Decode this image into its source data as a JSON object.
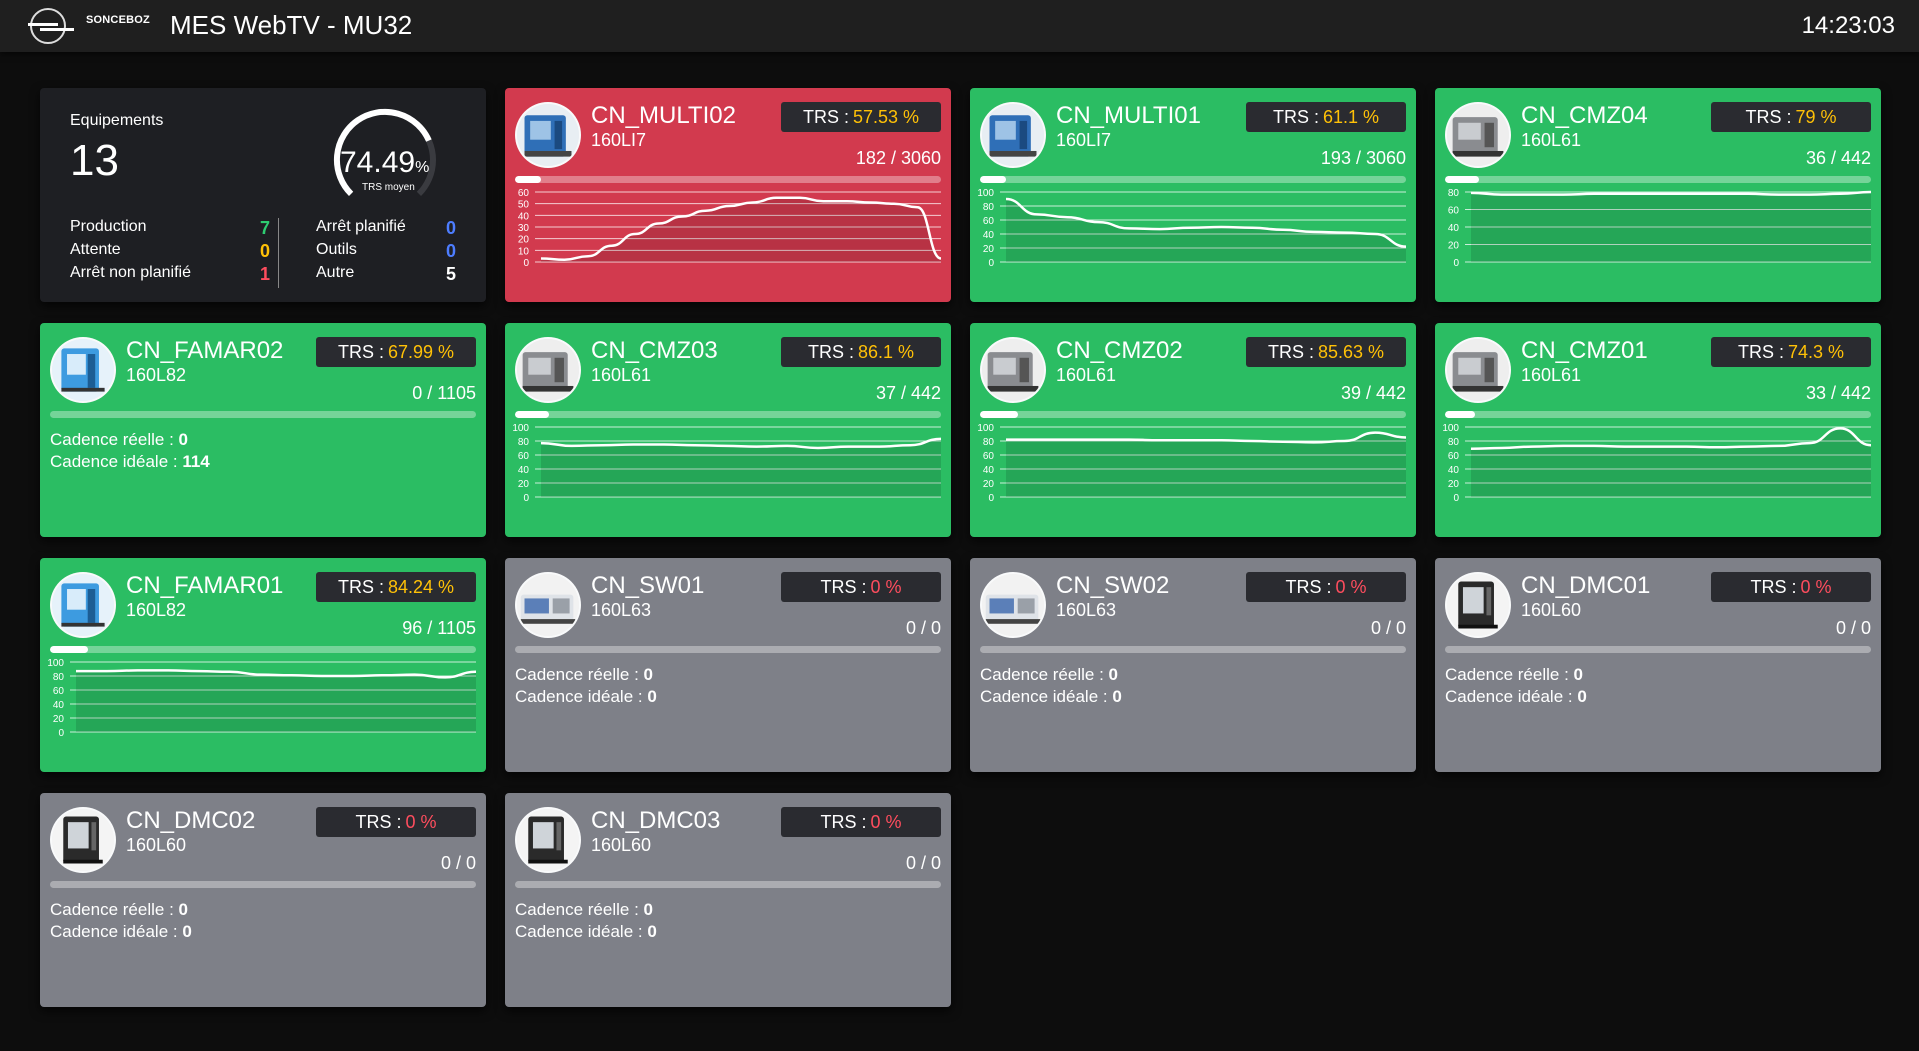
{
  "header": {
    "brand": "SONCEBOZ",
    "title": "MES WebTV - MU32",
    "clock": "14:23:03"
  },
  "colors": {
    "green": "#2bbd63",
    "red": "#d23a4e",
    "grey": "#7e8088",
    "trs_yellow": "#ffc107",
    "trs_red": "#ff4d5e"
  },
  "summary": {
    "label": "Equipements",
    "count": "13",
    "trs_value": "74.49",
    "trs_unit": "%",
    "trs_caption": "TRS moyen",
    "trs_fraction": 0.7449,
    "left_stats": [
      {
        "label": "Production",
        "value": "7",
        "color": "#2ecc71"
      },
      {
        "label": "Attente",
        "value": "0",
        "color": "#ffc107"
      },
      {
        "label": "Arrêt non planifié",
        "value": "1",
        "color": "#ff4d5e"
      }
    ],
    "right_stats": [
      {
        "label": "Arrêt planifié",
        "value": "0",
        "color": "#4d7dff"
      },
      {
        "label": "Outils",
        "value": "0",
        "color": "#4d7dff"
      },
      {
        "label": "Autre",
        "value": "5",
        "color": "#ffffff"
      }
    ]
  },
  "machines": [
    {
      "name": "CN_MULTI02",
      "ref": "160LI7",
      "trs_label": "TRS :",
      "trs": "57.53 %",
      "trs_color": "yellow",
      "counter": "182 / 3060",
      "progress": 0.06,
      "status": "red",
      "icon": "lathe-blue-icon",
      "chart": {
        "y_ticks": [
          "60",
          "50",
          "40",
          "30",
          "20",
          "10",
          "0"
        ],
        "ymax": 60,
        "values": [
          3,
          2,
          5,
          14,
          24,
          33,
          39,
          44,
          48,
          51,
          55,
          55,
          52,
          52,
          51,
          50,
          47,
          3
        ]
      }
    },
    {
      "name": "CN_MULTI01",
      "ref": "160LI7",
      "trs_label": "TRS :",
      "trs": "61.1 %",
      "trs_color": "yellow",
      "counter": "193 / 3060",
      "progress": 0.06,
      "status": "green",
      "icon": "lathe-blue-icon",
      "chart": {
        "y_ticks": [
          "100",
          "80",
          "60",
          "40",
          "20",
          "0"
        ],
        "ymax": 100,
        "values": [
          90,
          68,
          64,
          57,
          48,
          47,
          49,
          50,
          49,
          46,
          43,
          42,
          40,
          22
        ]
      }
    },
    {
      "name": "CN_CMZ04",
      "ref": "160L61",
      "trs_label": "TRS :",
      "trs": "79 %",
      "trs_color": "yellow",
      "counter": "36 / 442",
      "progress": 0.08,
      "status": "green",
      "icon": "lathe-grey-icon",
      "chart": {
        "y_ticks": [
          "80",
          "60",
          "40",
          "20",
          "0"
        ],
        "ymax": 80,
        "values": [
          79,
          77,
          77,
          77,
          78,
          78,
          78,
          78,
          78,
          78,
          77,
          77,
          78,
          80
        ]
      }
    },
    {
      "name": "CN_FAMAR02",
      "ref": "160L82",
      "trs_label": "TRS :",
      "trs": "67.99 %",
      "trs_color": "yellow",
      "counter": "0 / 1105",
      "progress": 0,
      "status": "green",
      "icon": "famar-icon",
      "cadence_real_label": "Cadence réelle :",
      "cadence_real": "0",
      "cadence_ideal_label": "Cadence idéale :",
      "cadence_ideal": "114"
    },
    {
      "name": "CN_CMZ03",
      "ref": "160L61",
      "trs_label": "TRS :",
      "trs": "86.1 %",
      "trs_color": "yellow",
      "counter": "37 / 442",
      "progress": 0.08,
      "status": "green",
      "icon": "lathe-grey-icon",
      "chart": {
        "y_ticks": [
          "100",
          "80",
          "60",
          "40",
          "20",
          "0"
        ],
        "ymax": 100,
        "values": [
          77,
          73,
          74,
          75,
          75,
          74,
          73,
          72,
          73,
          70,
          72,
          72,
          74,
          83
        ]
      }
    },
    {
      "name": "CN_CMZ02",
      "ref": "160L61",
      "trs_label": "TRS :",
      "trs": "85.63 %",
      "trs_color": "yellow",
      "counter": "39 / 442",
      "progress": 0.09,
      "status": "green",
      "icon": "lathe-grey-icon",
      "chart": {
        "y_ticks": [
          "100",
          "80",
          "60",
          "40",
          "20",
          "0"
        ],
        "ymax": 100,
        "values": [
          82,
          82,
          82,
          82,
          82,
          81,
          81,
          81,
          80,
          79,
          78,
          80,
          92,
          85
        ]
      }
    },
    {
      "name": "CN_CMZ01",
      "ref": "160L61",
      "trs_label": "TRS :",
      "trs": "74.3 %",
      "trs_color": "yellow",
      "counter": "33 / 442",
      "progress": 0.07,
      "status": "green",
      "icon": "lathe-grey-icon",
      "chart": {
        "y_ticks": [
          "100",
          "80",
          "60",
          "40",
          "20",
          "0"
        ],
        "ymax": 100,
        "values": [
          69,
          70,
          72,
          73,
          73,
          72,
          72,
          72,
          71,
          72,
          73,
          77,
          98,
          74
        ]
      }
    },
    {
      "name": "CN_FAMAR01",
      "ref": "160L82",
      "trs_label": "TRS :",
      "trs": "84.24 %",
      "trs_color": "yellow",
      "counter": "96 / 1105",
      "progress": 0.09,
      "status": "green",
      "icon": "famar-icon",
      "chart": {
        "y_ticks": [
          "100",
          "80",
          "60",
          "40",
          "20",
          "0"
        ],
        "ymax": 100,
        "values": [
          87,
          87,
          88,
          88,
          87,
          86,
          82,
          81,
          80,
          80,
          81,
          82,
          78,
          86
        ]
      }
    },
    {
      "name": "CN_SW01",
      "ref": "160L63",
      "trs_label": "TRS :",
      "trs": "0 %",
      "trs_color": "redtext",
      "counter": "0 / 0",
      "progress": 0,
      "status": "grey",
      "icon": "swiss-lathe-icon",
      "cadence_real_label": "Cadence réelle :",
      "cadence_real": "0",
      "cadence_ideal_label": "Cadence idéale :",
      "cadence_ideal": "0"
    },
    {
      "name": "CN_SW02",
      "ref": "160L63",
      "trs_label": "TRS :",
      "trs": "0 %",
      "trs_color": "redtext",
      "counter": "0 / 0",
      "progress": 0,
      "status": "grey",
      "icon": "swiss-lathe-icon",
      "cadence_real_label": "Cadence réelle :",
      "cadence_real": "0",
      "cadence_ideal_label": "Cadence idéale :",
      "cadence_ideal": "0"
    },
    {
      "name": "CN_DMC01",
      "ref": "160L60",
      "trs_label": "TRS :",
      "trs": "0 %",
      "trs_color": "redtext",
      "counter": "0 / 0",
      "progress": 0,
      "status": "grey",
      "icon": "mill-icon",
      "cadence_real_label": "Cadence réelle :",
      "cadence_real": "0",
      "cadence_ideal_label": "Cadence idéale :",
      "cadence_ideal": "0"
    },
    {
      "name": "CN_DMC02",
      "ref": "160L60",
      "trs_label": "TRS :",
      "trs": "0 %",
      "trs_color": "redtext",
      "counter": "0 / 0",
      "progress": 0,
      "status": "grey",
      "icon": "mill-icon",
      "cadence_real_label": "Cadence réelle :",
      "cadence_real": "0",
      "cadence_ideal_label": "Cadence idéale :",
      "cadence_ideal": "0"
    },
    {
      "name": "CN_DMC03",
      "ref": "160L60",
      "trs_label": "TRS :",
      "trs": "0 %",
      "trs_color": "redtext",
      "counter": "0 / 0",
      "progress": 0,
      "status": "grey",
      "icon": "mill-icon",
      "cadence_real_label": "Cadence réelle :",
      "cadence_real": "0",
      "cadence_ideal_label": "Cadence idéale :",
      "cadence_ideal": "0"
    }
  ]
}
